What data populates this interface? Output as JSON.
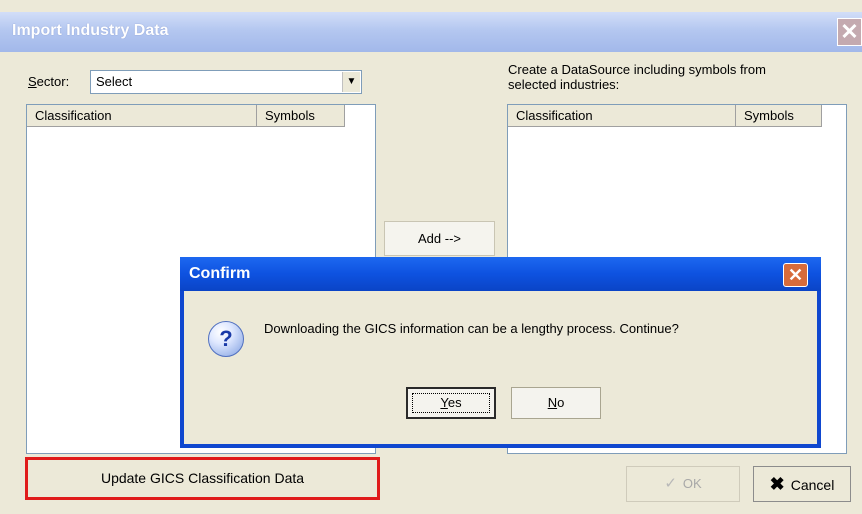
{
  "window": {
    "title": "Import Industry Data",
    "close_glyph": "✕"
  },
  "sector": {
    "label_key": "S",
    "label_rest": "ector:",
    "selected": "Select"
  },
  "left_list": {
    "columns": [
      "Classification",
      "Symbols"
    ]
  },
  "right_panel": {
    "description_line1": "Create a DataSource including symbols from",
    "description_line2": "selected industries:",
    "columns": [
      "Classification",
      "Symbols"
    ]
  },
  "add_button": {
    "label": "Add -->"
  },
  "update_button": {
    "label": "Update GICS Classification Data"
  },
  "ok_button": {
    "label": "OK",
    "icon": "check-icon"
  },
  "cancel_button": {
    "label": "Cancel",
    "icon": "x-icon"
  },
  "confirm": {
    "title": "Confirm",
    "message": "Downloading the GICS information can be a lengthy process.  Continue?",
    "yes_key": "Y",
    "yes_rest": "es",
    "no_key": "N",
    "no_rest": "o",
    "icon": "question-icon",
    "close_glyph": "✕"
  },
  "colors": {
    "confirm_title_bar": "#0e52e0",
    "highlight_border": "#e01b1b",
    "dialog_face": "#ece9d8"
  }
}
